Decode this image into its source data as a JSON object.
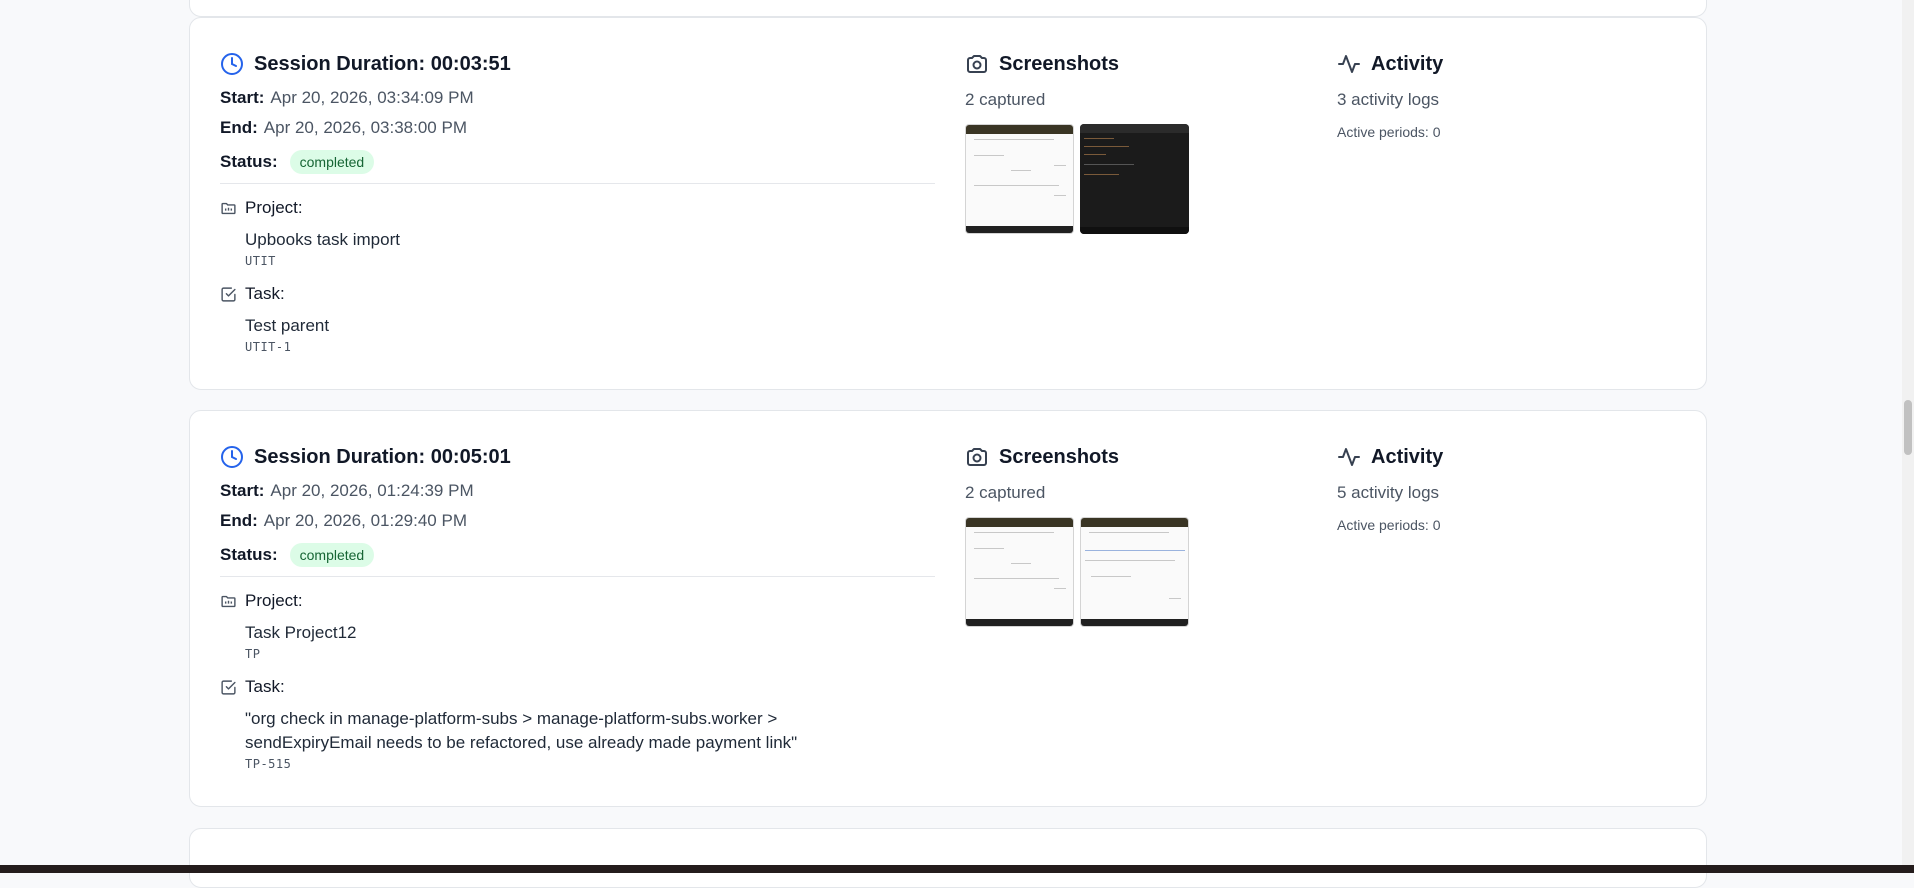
{
  "sessions": [
    {
      "duration_label": "Session Duration: 00:03:51",
      "start_label": "Start:",
      "start_value": "Apr 20, 2026, 03:34:09 PM",
      "end_label": "End:",
      "end_value": "Apr 20, 2026, 03:38:00 PM",
      "status_label": "Status:",
      "status_value": "completed",
      "project_label": "Project:",
      "project_name": "Upbooks task import",
      "project_code": "UTIT",
      "task_label": "Task:",
      "task_name": "Test parent",
      "task_code": "UTIT-1",
      "screenshots_label": "Screenshots",
      "screenshots_count": "2 captured",
      "activity_label": "Activity",
      "activity_logs": "3 activity logs",
      "active_periods": "Active periods: 0"
    },
    {
      "duration_label": "Session Duration: 00:05:01",
      "start_label": "Start:",
      "start_value": "Apr 20, 2026, 01:24:39 PM",
      "end_label": "End:",
      "end_value": "Apr 20, 2026, 01:29:40 PM",
      "status_label": "Status:",
      "status_value": "completed",
      "project_label": "Project:",
      "project_name": "Task Project12",
      "project_code": "TP",
      "task_label": "Task:",
      "task_name": "\"org check in manage-platform-subs > manage-platform-subs.worker > sendExpiryEmail needs to be refactored, use already made payment link\"",
      "task_code": "TP-515",
      "screenshots_label": "Screenshots",
      "screenshots_count": "2 captured",
      "activity_label": "Activity",
      "activity_logs": "5 activity logs",
      "active_periods": "Active periods: 0"
    }
  ],
  "colors": {
    "accent": "#2563eb",
    "status_bg": "#dcfce7",
    "status_text": "#166534"
  },
  "icons": {
    "duration": "clock-icon",
    "screenshots": "camera-icon",
    "activity": "activity-pulse-icon",
    "project": "folder-icon",
    "task": "checkbox-icon"
  }
}
